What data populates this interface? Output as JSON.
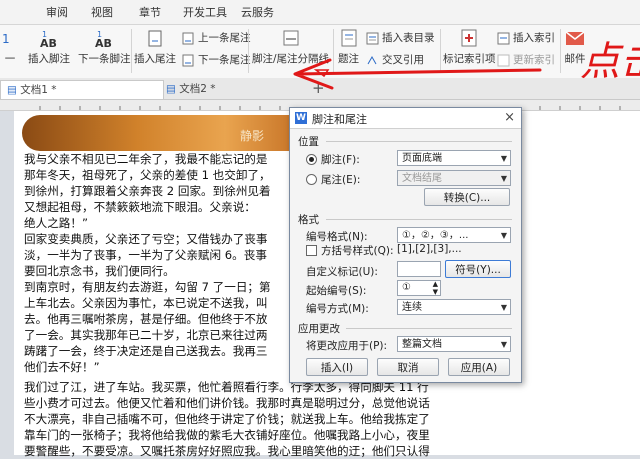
{
  "ribbon_tabs": [
    "审阅",
    "视图",
    "章节",
    "开发工具",
    "云服务"
  ],
  "ribbon": {
    "left_cut_label": "一",
    "insert_footnote": "插入脚注",
    "next_footnote": "下一条脚注",
    "insert_endnote": "插入尾注",
    "prev_endnote": "上一条尾注",
    "next_endnote": "下一条尾注",
    "separator": "脚注/尾注分隔线",
    "caption": "题注",
    "cross_ref": "交叉引用",
    "insert_toc_entry": "插入表目录",
    "mark_index": "标记索引项",
    "insert_index": "插入索引",
    "update_index": "更新索引",
    "mail": "邮件"
  },
  "doc_tabs": [
    "文档1 *",
    "文档2 *"
  ],
  "new_tab_symbol": "+",
  "banner_text": "静影",
  "doc_lines": [
    "我与父亲不相见已二年余了，我最不能忘记的是",
    "那年冬天，祖母死了，父亲的差使 1 也交卸了，",
    "到徐州，打算跟着父亲奔丧 2 回家。到徐州见着",
    "又想起祖母，不禁簌簌地流下眼泪。父亲说：",
    "绝人之路！”",
    "回家变卖典质，父亲还了亏空；又借钱办了丧事",
    "淡，一半为了丧事，一半为了父亲赋闲 6。丧事",
    "要回北京念书，我们便同行。",
    "到南京时，有朋友约去游逛，勾留 7 了一日；第",
    "上车北去。父亲因为事忙，本已说定不送我，叫",
    "去。他再三嘱咐茶房，甚是仔细。但他终于不放",
    "了一会。其实我那年已二十岁，北京已来往过两",
    "踌躇了一会，终于决定还是自己送我去。我再三",
    "他们去不好！”"
  ],
  "doc_lines_full": [
    "我们过了江，进了车站。我买票，他忙着照看行李。行李太多，得向脚夫 11 行",
    "些小费才可过去。他便又忙着和他们讲价钱。我那时真是聪明过分，总觉他说话",
    "不大漂亮，非自己插嘴不可，但他终于讲定了价钱；就送我上车。他给我拣定了",
    "靠车门的一张椅子；我将他给我做的紫毛大衣铺好座位。他嘱我路上小心，夜里",
    "要警醒些，不要受凉。又嘱托茶房好好照应我。我心里暗笑他的迂；他们只认得"
  ],
  "dialog": {
    "title": "脚注和尾注",
    "close": "×",
    "position_label": "位置",
    "footnote_label": "脚注(F):",
    "footnote_value": "页面底端",
    "endnote_label": "尾注(E):",
    "endnote_value": "文档结尾",
    "convert_button": "转换(C)...",
    "format_label": "格式",
    "number_format_label": "编号格式(N):",
    "number_format_value": "①，②，③，...",
    "square_style_label": "方括号样式(Q):",
    "square_style_value": "[1],[2],[3],...",
    "custom_mark_label": "自定义标记(U):",
    "custom_mark_value": "",
    "symbol_button": "符号(Y)...",
    "start_label": "起始编号(S):",
    "start_value": "①",
    "numbering_label": "编号方式(M):",
    "numbering_value": "连续",
    "apply_group_label": "应用更改",
    "apply_to_label": "将更改应用于(P):",
    "apply_to_value": "整篇文档",
    "insert_button": "插入(I)",
    "cancel_button": "取消",
    "apply_button": "应用(A)"
  },
  "annotation_text": "点击",
  "colors": {
    "accent": "#2b6bc7",
    "annotation": "#e01818",
    "dialog_icon": "#2f6fd6"
  }
}
